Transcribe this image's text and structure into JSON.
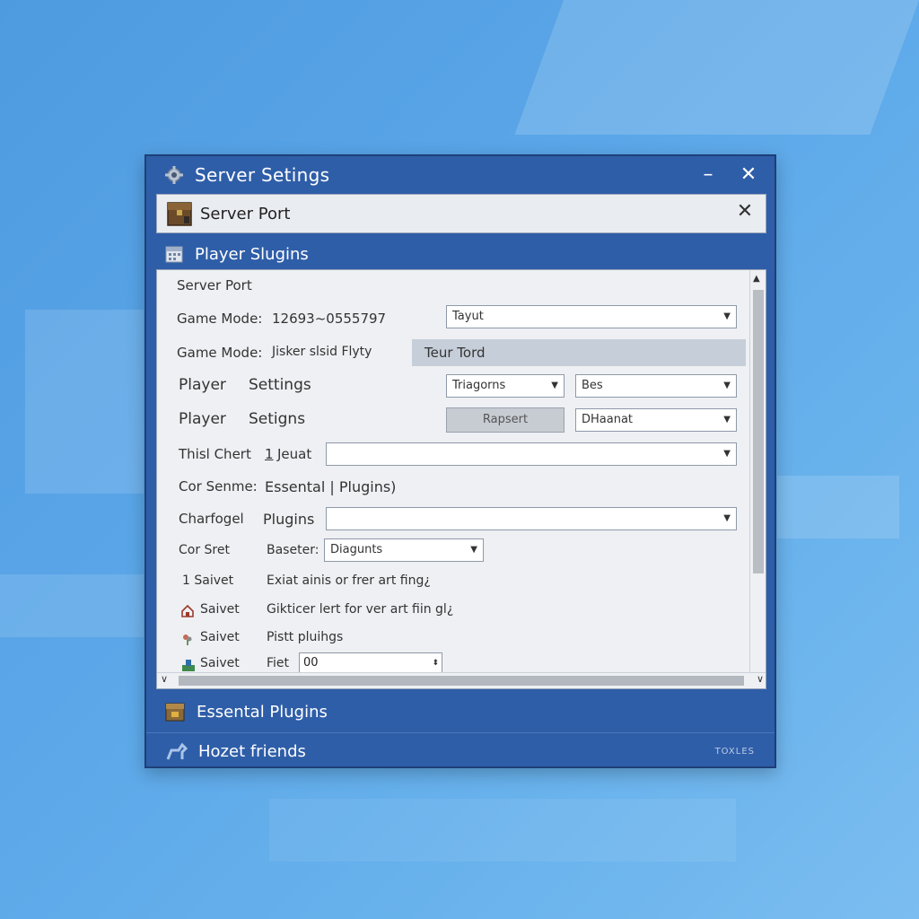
{
  "window": {
    "title": "Server Setings",
    "minimize_glyph": "–",
    "close_glyph": "✕"
  },
  "port_bar": {
    "label": "Server Port",
    "close_glyph": "✕"
  },
  "section_player": {
    "label": "Player Slugins"
  },
  "panel": {
    "header": "Server Port",
    "rows": [
      {
        "label": "Game Mode:",
        "value": "12693~0555797",
        "dropdown": "Tayut"
      },
      {
        "label": "Game Mode:",
        "value": "Jisker slsid Flyty",
        "banner": "Teur Tord"
      },
      {
        "label": "Player",
        "value": "Settings",
        "dropdown_a": "Triagorns",
        "dropdown_b": "Bes"
      },
      {
        "label": "Player",
        "value": "Setigns",
        "button": "Rapsert",
        "dropdown": "DHaanat"
      },
      {
        "label": "Thisl Chert",
        "link": "1",
        "value": "Jeuat"
      },
      {
        "label": "Cor Senme:",
        "value": "Essental | Plugins)"
      },
      {
        "label": "Charfogel",
        "value": "Plugins"
      },
      {
        "label": "Cor Sret",
        "value": "Baseter:",
        "dropdown": "Diagunts"
      },
      {
        "label": "1  Saivet",
        "value": "Exiat ainis or frer art fing¿"
      },
      {
        "label": "Saivet",
        "value": "Gikticer lert for ver art fiin gl¿"
      },
      {
        "label": "Saivet",
        "value": "Pistt pluihgs"
      },
      {
        "label": "Saivet",
        "value": "Fiet",
        "input": "00"
      }
    ]
  },
  "section_essential": {
    "label": "Essental Plugins"
  },
  "section_friends": {
    "label": "Hozet friends",
    "tag": "TOXLES"
  },
  "glyphs": {
    "dropdown_arrow": "▼",
    "scroll_up": "▲",
    "scroll_down": "∨",
    "scroll_left": "‹",
    "scroll_right": "›",
    "spin": "⬍"
  },
  "colors": {
    "window_blue": "#2f5ea8",
    "panel_bg": "#eef0f3",
    "accent_link": "#2e68c4"
  },
  "icons": [
    "gear-icon",
    "chest-icon",
    "calendar-icon",
    "furnace-icon",
    "horse-icon",
    "house-icon",
    "flower-icon",
    "sapling-icon"
  ]
}
